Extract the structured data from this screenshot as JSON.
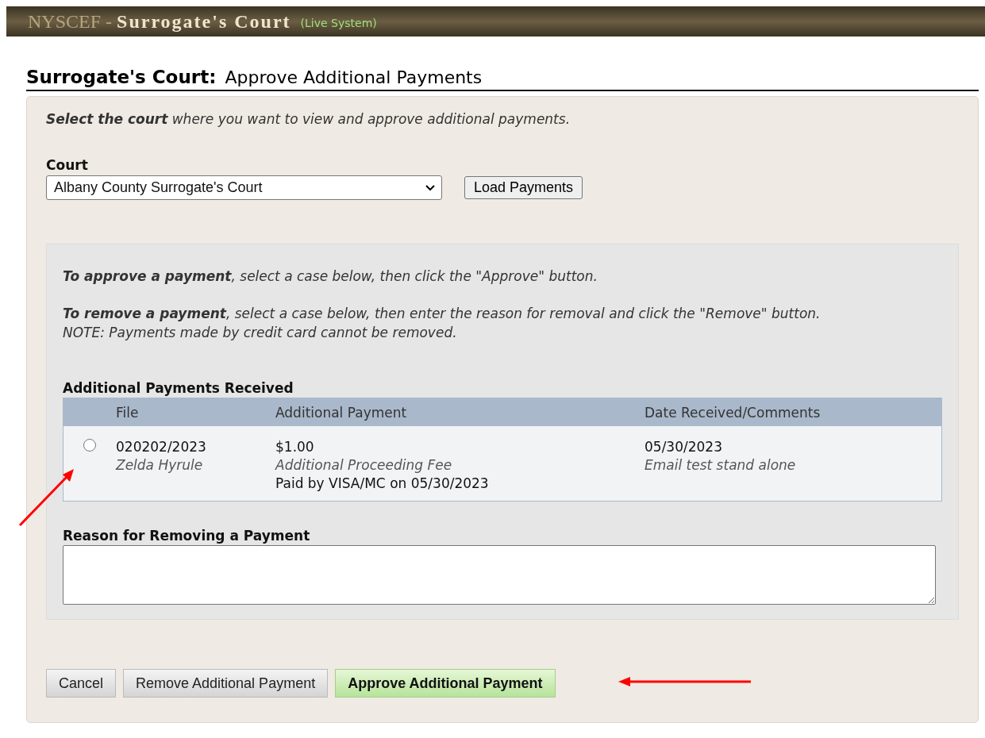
{
  "header": {
    "system": "NYSCEF",
    "separator": "-",
    "court": "Surrogate's Court",
    "status": "(Live System)"
  },
  "page_title": {
    "court": "Surrogate's Court:",
    "action": "Approve Additional Payments"
  },
  "intro": "**Select the court** where you want to view and approve additional payments.",
  "court_field": {
    "label": "Court",
    "value": "Albany County Surrogate's Court"
  },
  "load_button": "Load Payments",
  "instructions": [
    {
      "text": "**To approve a payment**, select a case below, then click the \"Approve\" button."
    },
    {
      "text": "**To remove a payment**, select a case below, then enter the reason for removal and click the \"Remove\" button."
    },
    {
      "text": "NOTE: Payments made by credit card cannot be removed."
    }
  ],
  "payments": {
    "title": "Additional Payments Received",
    "columns": [
      "File",
      "Additional Payment",
      "Date Received/Comments"
    ],
    "rows": [
      {
        "selected": false,
        "file": "020202/2023",
        "name": "Zelda Hyrule",
        "amount": "$1.00",
        "fee": "Additional Proceeding Fee",
        "paid_by": "Paid by VISA/MC on 05/30/2023",
        "date": "05/30/2023",
        "comment": "Email test stand alone"
      }
    ]
  },
  "reason": {
    "label": "Reason for Removing a Payment"
  },
  "buttons": [
    {
      "label": "Cancel",
      "kind": "plain"
    },
    {
      "label": "Remove Additional Payment",
      "kind": "plain"
    },
    {
      "label": "Approve Additional Payment",
      "kind": "primary"
    }
  ]
}
